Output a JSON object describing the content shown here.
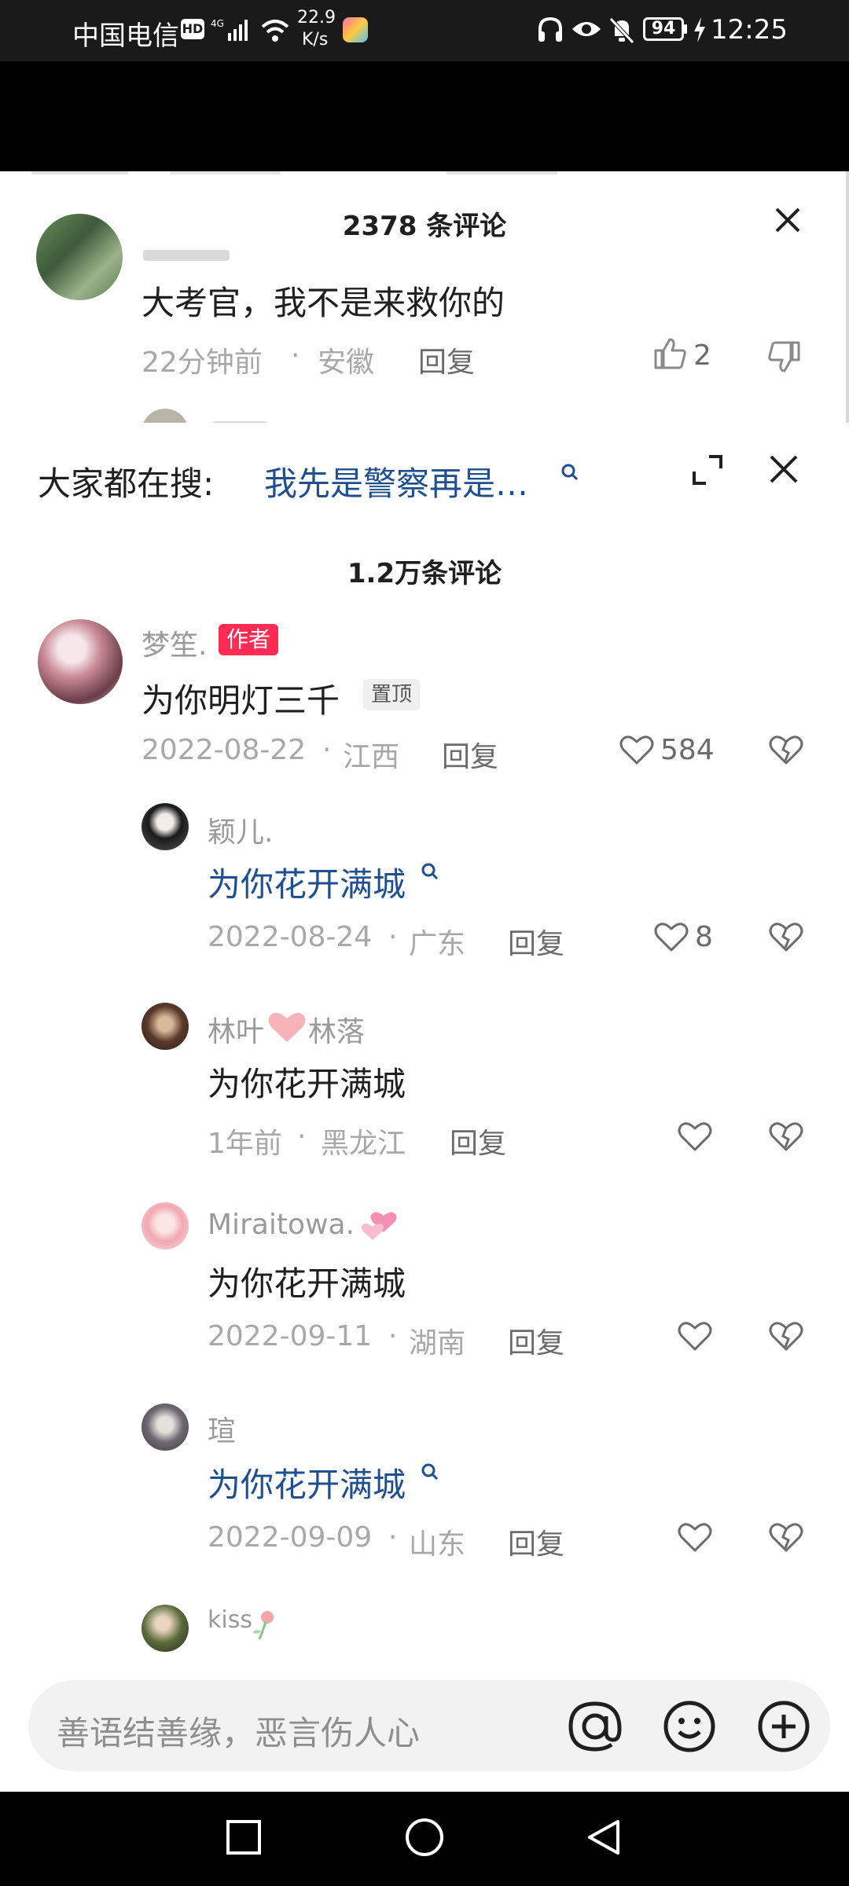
{
  "status_bar": {
    "carrier": "中国电信",
    "hd": "HD",
    "net_speed_value": "22.9",
    "net_speed_unit": "K/s",
    "battery": "94",
    "time": "12:25"
  },
  "background_sheet": {
    "title": "2378 条评论",
    "comment": {
      "text": "大考官，我不是来救你的",
      "time": "22分钟前",
      "location": "安徽",
      "reply_label": "回复",
      "likes": "2"
    }
  },
  "search_banner": {
    "label": "大家都在搜:",
    "query": "我先是警察再是…"
  },
  "sheet": {
    "title": "1.2万条评论"
  },
  "comments": [
    {
      "name": "梦笙.",
      "badge": "作者",
      "text": "为你明灯三千",
      "pin": "置顶",
      "date": "2022-08-22",
      "location": "江西",
      "reply_label": "回复",
      "likes": "584"
    }
  ],
  "replies": [
    {
      "name": "颖儿.",
      "text": "为你花开满城",
      "is_link": true,
      "date": "2022-08-24",
      "location": "广东",
      "reply_label": "回复",
      "likes": "8"
    },
    {
      "name_a": "林叶",
      "name_b": "林落",
      "text": "为你花开满城",
      "is_link": false,
      "date": "1年前",
      "location": "黑龙江",
      "reply_label": "回复",
      "likes": ""
    },
    {
      "name": "Miraitowa.",
      "text": "为你花开满城",
      "is_link": false,
      "date": "2022-09-11",
      "location": "湖南",
      "reply_label": "回复",
      "likes": ""
    },
    {
      "name": "瑄",
      "text": "为你花开满城",
      "is_link": true,
      "date": "2022-09-09",
      "location": "山东",
      "reply_label": "回复",
      "likes": ""
    },
    {
      "name": "kiss"
    }
  ],
  "input": {
    "placeholder": "善语结善缘，恶言伤人心"
  },
  "colors": {
    "author_badge": "#fe2c55",
    "link_blue": "#1f4f8f",
    "nav_bar": "#000000"
  }
}
